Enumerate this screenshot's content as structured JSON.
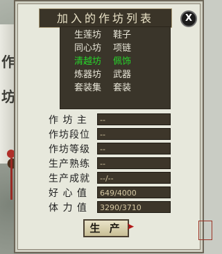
{
  "panel": {
    "title": "加入的作坊列表",
    "close_label": "X"
  },
  "side_scroll": {
    "chars": [
      "作",
      "坊"
    ]
  },
  "workshops": [
    {
      "name": "生莲坊",
      "item": "鞋子",
      "selected": false
    },
    {
      "name": "同心坊",
      "item": "项链",
      "selected": false
    },
    {
      "name": "清越坊",
      "item": "佩饰",
      "selected": true
    },
    {
      "name": "炼器坊",
      "item": "武器",
      "selected": false
    },
    {
      "name": "套装集",
      "item": "套装",
      "selected": false
    }
  ],
  "fields": [
    {
      "label": "作 坊 主",
      "value": "--"
    },
    {
      "label": "作坊段位",
      "value": "--"
    },
    {
      "label": "作坊等级",
      "value": "--"
    },
    {
      "label": "生产熟练",
      "value": "--"
    },
    {
      "label": "生产成就",
      "value": "--/--"
    },
    {
      "label": "好 心 值",
      "value": "649/4000"
    },
    {
      "label": "体 力 值",
      "value": "3290/3710"
    }
  ],
  "produce_label": "生 产",
  "colors": {
    "selected_text": "#27d42a",
    "panel_bg": "#e7e8dc",
    "field_bg": "#3d362a"
  }
}
